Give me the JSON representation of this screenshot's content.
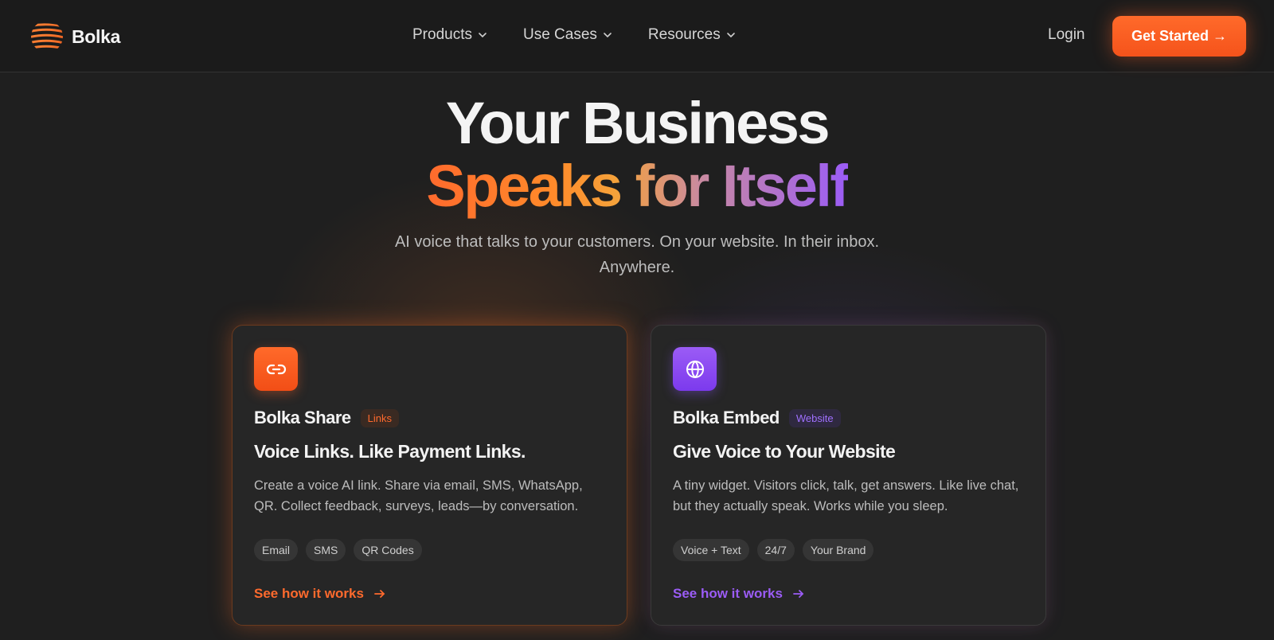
{
  "header": {
    "brand": "Bolka",
    "nav": [
      {
        "label": "Products"
      },
      {
        "label": "Use Cases"
      },
      {
        "label": "Resources"
      }
    ],
    "login_label": "Login",
    "cta_label": "Get Started →"
  },
  "hero": {
    "title_line1": "Your Business",
    "title_line2": "Speaks for Itself",
    "subtitle": "AI voice that talks to your customers. On your website. In their inbox. Anywhere."
  },
  "cards": [
    {
      "icon": "link-icon",
      "name": "Bolka Share",
      "badge": "Links",
      "headline": "Voice Links. Like Payment Links.",
      "description": "Create a voice AI link. Share via email, SMS, WhatsApp, QR. Collect feedback, surveys, leads—by conversation.",
      "tags": [
        "Email",
        "SMS",
        "QR Codes"
      ],
      "link_label": "See how it works",
      "accent": "#ff6a2d"
    },
    {
      "icon": "globe-icon",
      "name": "Bolka Embed",
      "badge": "Website",
      "headline": "Give Voice to Your Website",
      "description": "A tiny widget. Visitors click, talk, get answers. Like live chat, but they actually speak. Works while you sleep.",
      "tags": [
        "Voice + Text",
        "24/7",
        "Your Brand"
      ],
      "link_label": "See how it works",
      "accent": "#9b5cf6"
    }
  ]
}
